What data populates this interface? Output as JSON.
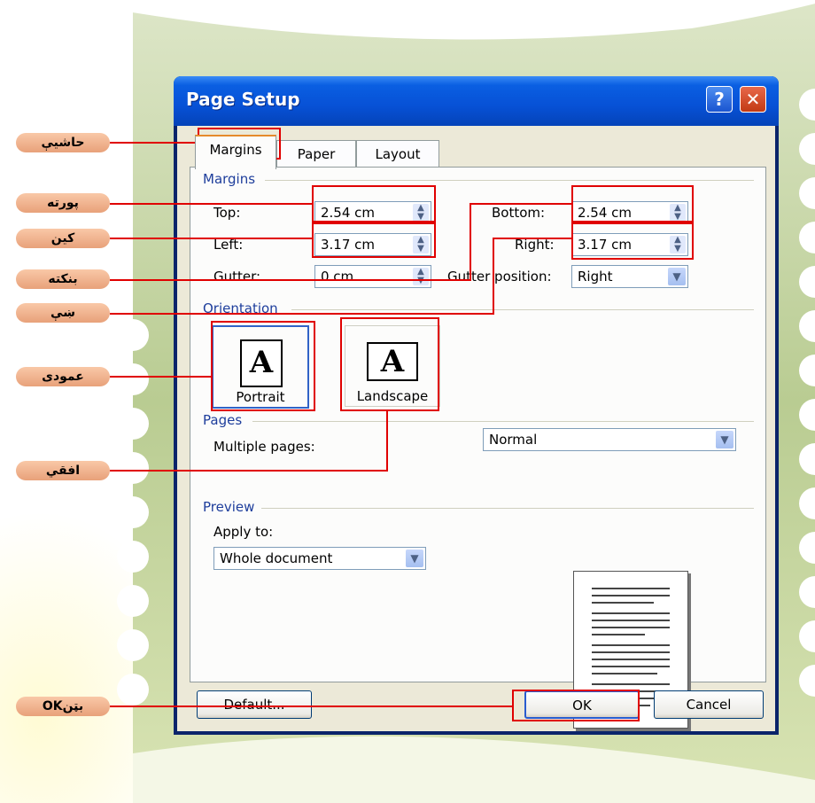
{
  "dialog": {
    "title": "Page Setup",
    "help_label": "?",
    "close_label": "✕",
    "tabs": [
      {
        "label": "Margins",
        "active": true
      },
      {
        "label": "Paper",
        "active": false
      },
      {
        "label": "Layout",
        "active": false
      }
    ],
    "margins": {
      "section": "Margins",
      "top_label": "Top:",
      "top_value": "2.54 cm",
      "bottom_label": "Bottom:",
      "bottom_value": "2.54 cm",
      "left_label": "Left:",
      "left_value": "3.17 cm",
      "right_label": "Right:",
      "right_value": "3.17 cm",
      "gutter_label": "Gutter:",
      "gutter_value": "0 cm",
      "gutter_position_label": "Gutter position:",
      "gutter_position_value": "Right"
    },
    "orientation": {
      "section": "Orientation",
      "portrait_label": "Portrait",
      "landscape_label": "Landscape",
      "glyph": "A"
    },
    "pages": {
      "section": "Pages",
      "multiple_label": "Multiple pages:",
      "multiple_value": "Normal"
    },
    "preview": {
      "section": "Preview",
      "apply_label": "Apply to:",
      "apply_value": "Whole document"
    },
    "buttons": {
      "default": "Default...",
      "ok": "OK",
      "cancel": "Cancel"
    }
  },
  "callouts": {
    "margins_tab": "حاشیې",
    "top": "پورته",
    "left": "کین",
    "gutter": "بنکته",
    "right": "ښې",
    "portrait": "عمودی",
    "landscape": "افقي",
    "ok": "OKبټن"
  },
  "colors": {
    "title_bar": "#0751d6",
    "dialog_face": "#ece9d8",
    "highlight": "#e00000",
    "callout": "#f2b48f",
    "frame_green": "#c5d6a4"
  }
}
